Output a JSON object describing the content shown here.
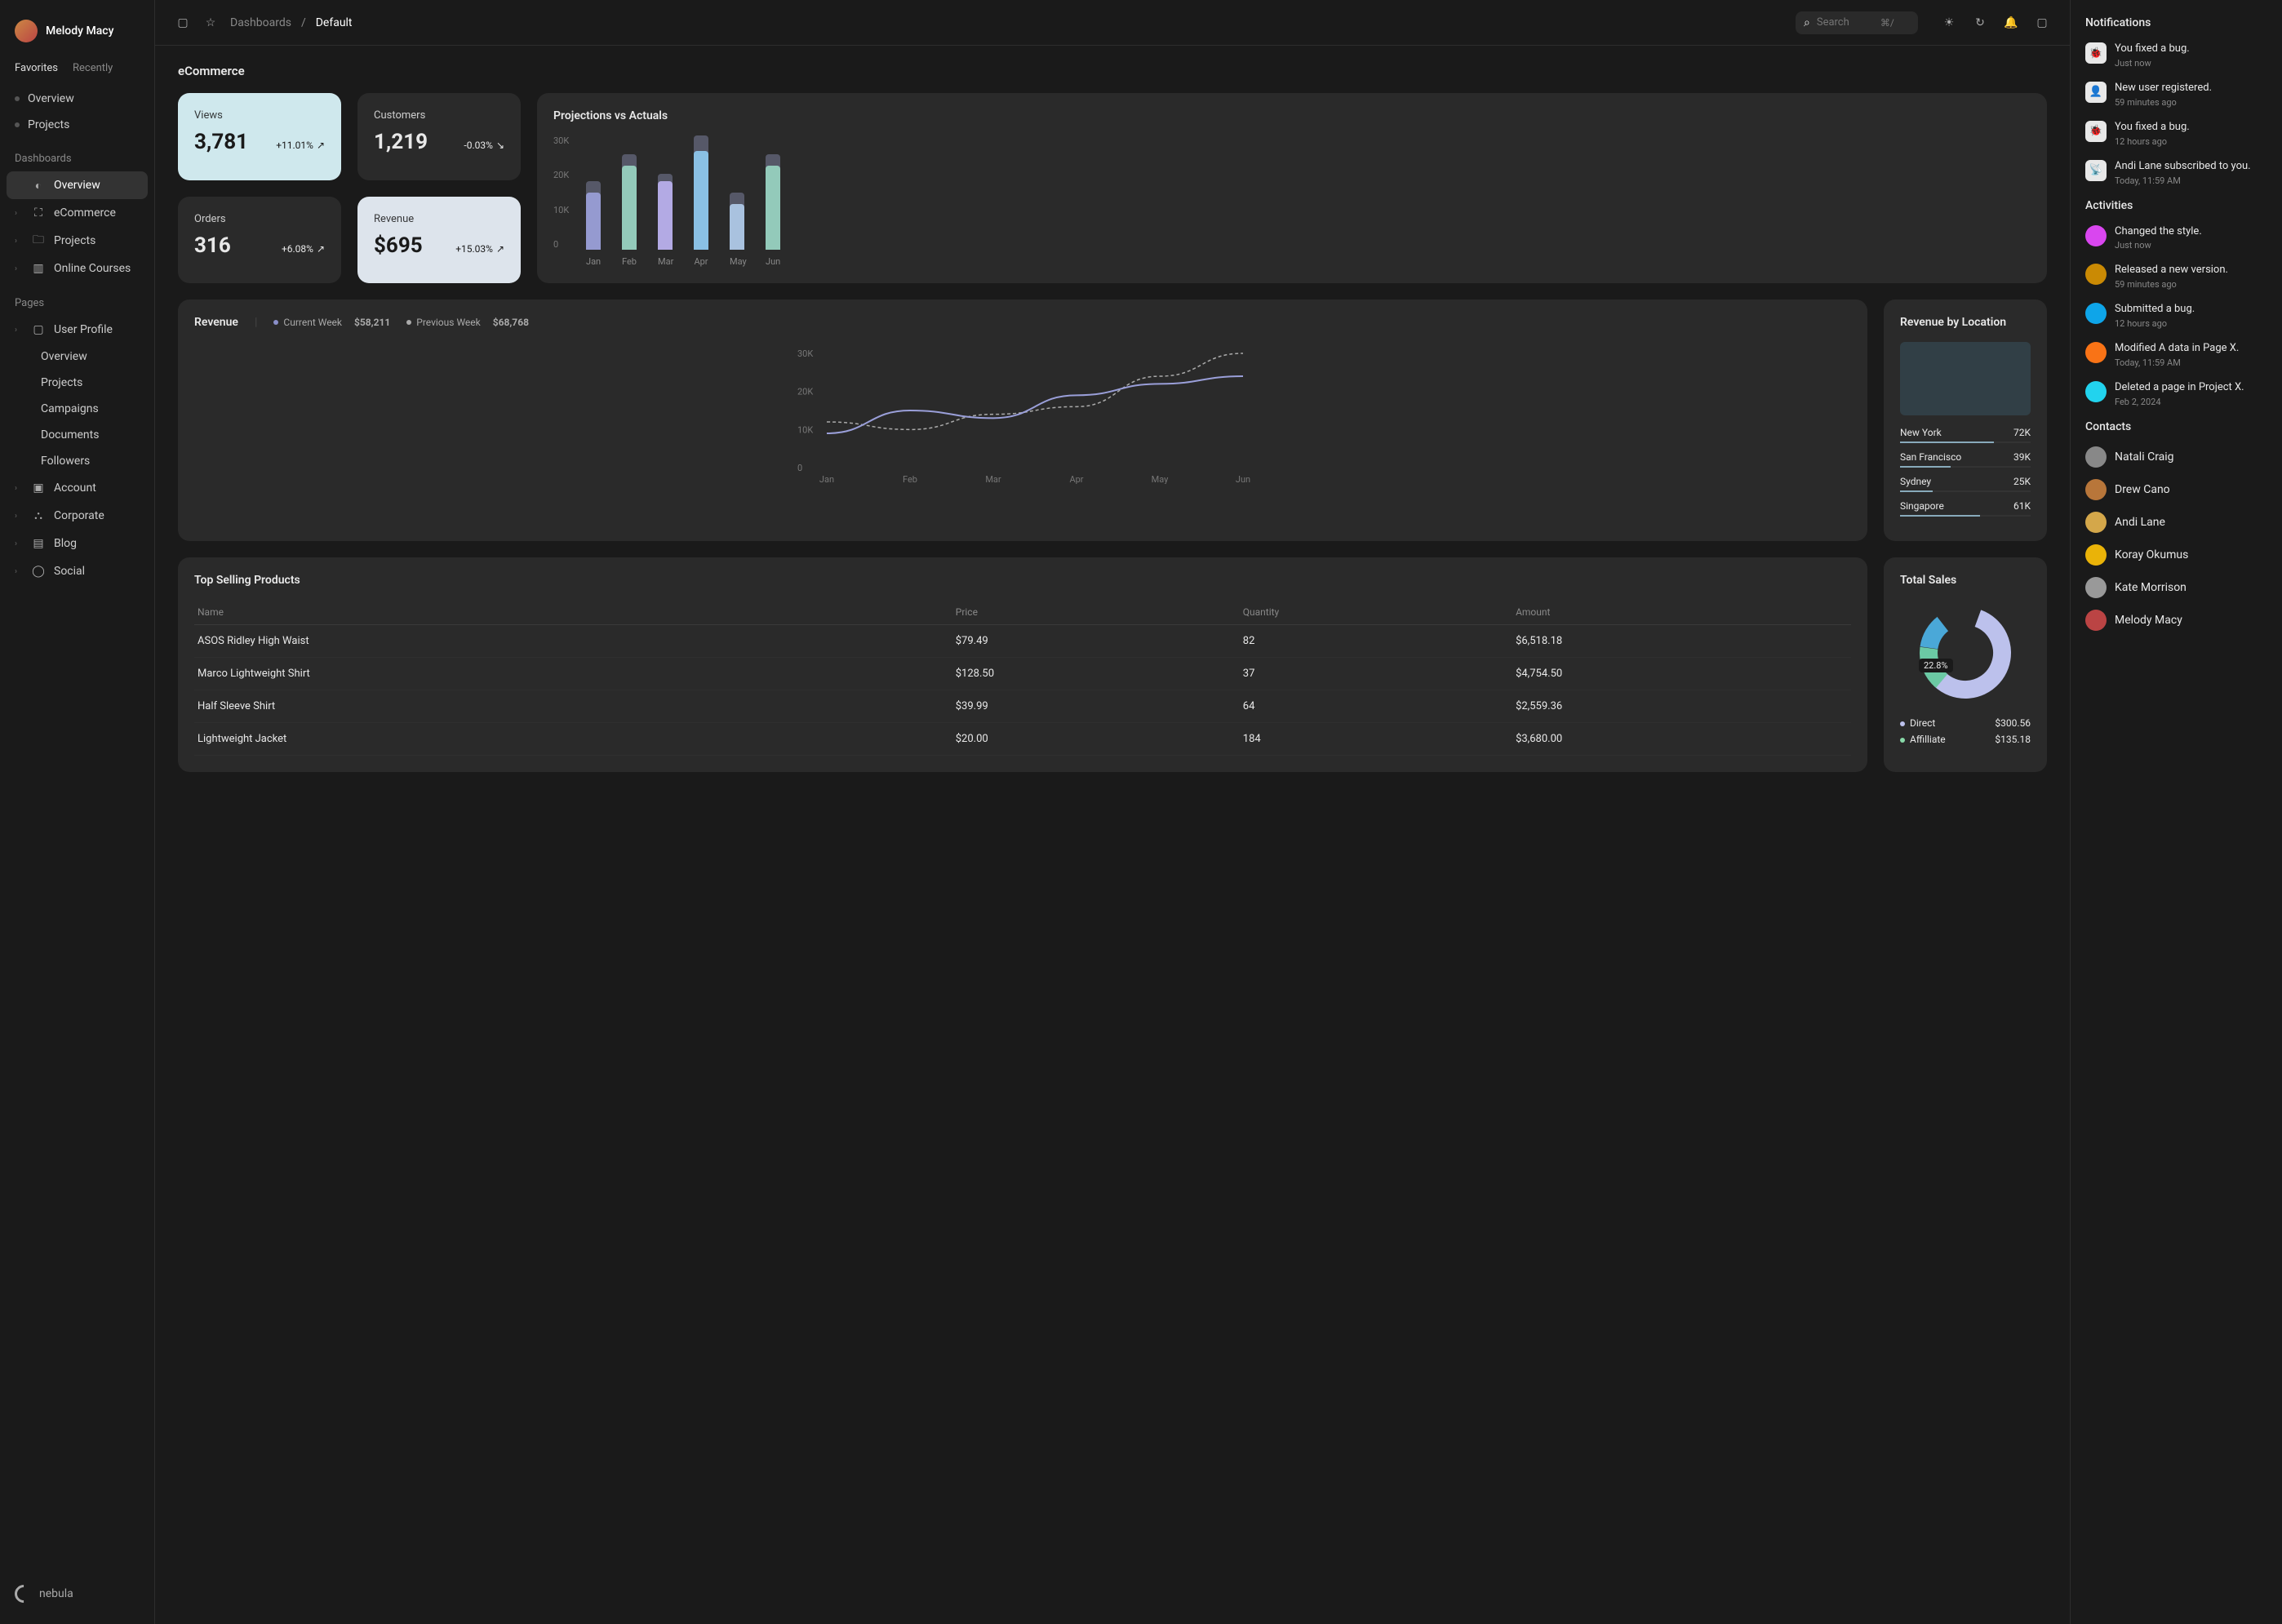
{
  "user": {
    "name": "Melody Macy"
  },
  "favTabs": [
    "Favorites",
    "Recently"
  ],
  "favItems": [
    "Overview",
    "Projects"
  ],
  "dashLabel": "Dashboards",
  "dashItems": [
    {
      "label": "Overview",
      "icon": "pie"
    },
    {
      "label": "eCommerce",
      "icon": "cart"
    },
    {
      "label": "Projects",
      "icon": "folder"
    },
    {
      "label": "Online Courses",
      "icon": "book"
    }
  ],
  "pagesLabel": "Pages",
  "pagesItems": [
    {
      "label": "User Profile",
      "icon": "id",
      "children": [
        "Overview",
        "Projects",
        "Campaigns",
        "Documents",
        "Followers"
      ]
    },
    {
      "label": "Account",
      "icon": "account"
    },
    {
      "label": "Corporate",
      "icon": "corp"
    },
    {
      "label": "Blog",
      "icon": "blog"
    },
    {
      "label": "Social",
      "icon": "social"
    }
  ],
  "logo": "nebula",
  "breadcrumb": {
    "root": "Dashboards",
    "sep": "/",
    "current": "Default"
  },
  "search": {
    "placeholder": "Search",
    "kbd": "⌘/"
  },
  "pageTitle": "eCommerce",
  "stats": [
    {
      "label": "Views",
      "value": "3,781",
      "delta": "+11.01%",
      "light": true
    },
    {
      "label": "Customers",
      "value": "1,219",
      "delta": "-0.03%",
      "light": false
    },
    {
      "label": "Orders",
      "value": "316",
      "delta": "+6.08%",
      "light": false
    },
    {
      "label": "Revenue",
      "value": "$695",
      "delta": "+15.03%",
      "light": true,
      "light2": true
    }
  ],
  "projTitle": "Projections vs Actuals",
  "revenueCard": {
    "title": "Revenue",
    "legend": [
      {
        "label": "Current Week",
        "val": "$58,211",
        "color": "#8a8fc9"
      },
      {
        "label": "Previous Week",
        "val": "$68,768",
        "color": "#aaa"
      }
    ]
  },
  "locTitle": "Revenue by Location",
  "locations": [
    {
      "name": "New York",
      "val": "72K",
      "pct": 72
    },
    {
      "name": "San Francisco",
      "val": "39K",
      "pct": 39
    },
    {
      "name": "Sydney",
      "val": "25K",
      "pct": 25
    },
    {
      "name": "Singapore",
      "val": "61K",
      "pct": 61
    }
  ],
  "tableTitle": "Top Selling Products",
  "tableHead": [
    "Name",
    "Price",
    "Quantity",
    "Amount"
  ],
  "tableRows": [
    [
      "ASOS Ridley High Waist",
      "$79.49",
      "82",
      "$6,518.18"
    ],
    [
      "Marco Lightweight Shirt",
      "$128.50",
      "37",
      "$4,754.50"
    ],
    [
      "Half Sleeve  Shirt",
      "$39.99",
      "64",
      "$2,559.36"
    ],
    [
      "Lightweight Jacket",
      "$20.00",
      "184",
      "$3,680.00"
    ]
  ],
  "donutTitle": "Total Sales",
  "donutLabel": "22.8%",
  "donutLegend": [
    {
      "label": "Direct",
      "val": "$300.56",
      "color": "#bcc1ec"
    },
    {
      "label": "Affilliate",
      "val": "$135.18",
      "color": "#88d9a8"
    }
  ],
  "notifTitle": "Notifications",
  "notifs": [
    {
      "text": "You fixed a bug.",
      "time": "Just now",
      "icon": "bug"
    },
    {
      "text": "New user registered.",
      "time": "59 minutes ago",
      "icon": "user"
    },
    {
      "text": "You fixed a bug.",
      "time": "12 hours ago",
      "icon": "bug"
    },
    {
      "text": "Andi Lane subscribed to you.",
      "time": "Today, 11:59 AM",
      "icon": "sub"
    }
  ],
  "actTitle": "Activities",
  "acts": [
    {
      "text": "Changed the style.",
      "time": "Just now",
      "color": "#d946ef"
    },
    {
      "text": "Released a new version.",
      "time": "59 minutes ago",
      "color": "#ca8a04"
    },
    {
      "text": "Submitted a bug.",
      "time": "12 hours ago",
      "color": "#0ea5e9"
    },
    {
      "text": "Modified A data in Page X.",
      "time": "Today, 11:59 AM",
      "color": "#f97316"
    },
    {
      "text": "Deleted a page in Project X.",
      "time": "Feb 2, 2024",
      "color": "#22d3ee"
    }
  ],
  "contactsTitle": "Contacts",
  "contacts": [
    {
      "name": "Natali Craig",
      "color": "#888"
    },
    {
      "name": "Drew Cano",
      "color": "#b8763a"
    },
    {
      "name": "Andi Lane",
      "color": "#d4a74a"
    },
    {
      "name": "Koray Okumus",
      "color": "#eab308"
    },
    {
      "name": "Kate Morrison",
      "color": "#999"
    },
    {
      "name": "Melody Macy",
      "color": "#b44"
    }
  ],
  "chart_data": [
    {
      "type": "bar",
      "title": "Projections vs Actuals",
      "categories": [
        "Jan",
        "Feb",
        "Mar",
        "Apr",
        "May",
        "Jun"
      ],
      "series": [
        {
          "name": "Actuals",
          "values": [
            15000,
            22000,
            18000,
            26000,
            12000,
            22000
          ]
        },
        {
          "name": "Projections",
          "values": [
            18000,
            25000,
            20000,
            30000,
            15000,
            25000
          ]
        }
      ],
      "ylabel": "",
      "ylim": [
        0,
        30000
      ],
      "yticks": [
        0,
        10000,
        20000,
        30000
      ],
      "yticklabels": [
        "0",
        "10K",
        "20K",
        "30K"
      ]
    },
    {
      "type": "line",
      "title": "Revenue",
      "x": [
        "Jan",
        "Feb",
        "Mar",
        "Apr",
        "May",
        "Jun"
      ],
      "series": [
        {
          "name": "Current Week",
          "values": [
            9000,
            15000,
            13000,
            19000,
            22000,
            24000
          ]
        },
        {
          "name": "Previous Week",
          "values": [
            12000,
            10000,
            14000,
            16000,
            24000,
            30000
          ]
        }
      ],
      "ylim": [
        0,
        30000
      ],
      "yticks": [
        0,
        10000,
        20000,
        30000
      ],
      "yticklabels": [
        "0",
        "10K",
        "20K",
        "30K"
      ]
    },
    {
      "type": "pie",
      "title": "Total Sales",
      "slices": [
        {
          "label": "Direct",
          "value": 300.56
        },
        {
          "label": "Affilliate",
          "value": 135.18
        }
      ],
      "highlight_pct": 22.8
    }
  ]
}
